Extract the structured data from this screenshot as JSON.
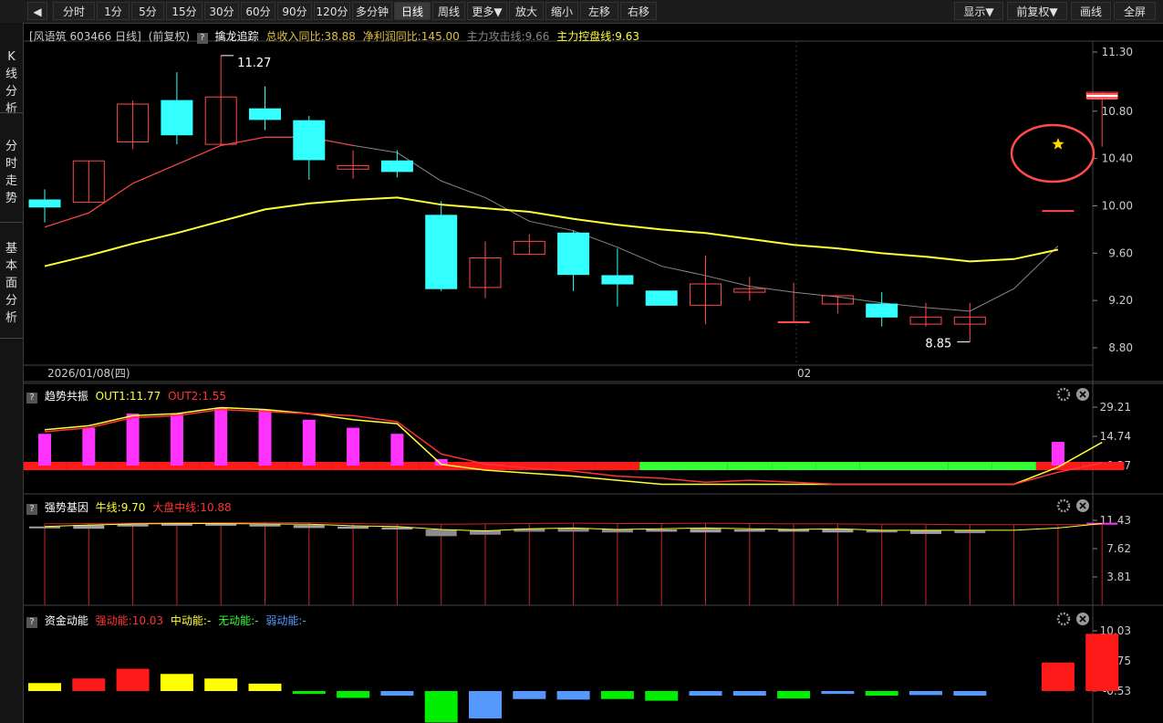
{
  "toolbar": {
    "back_icon": "back-arrow-icon",
    "left_buttons": [
      "分时",
      "1分",
      "5分",
      "15分",
      "30分",
      "60分",
      "90分",
      "120分",
      "多分钟",
      "日线",
      "周线",
      "更多▼",
      "放大",
      "缩小",
      "左移",
      "右移"
    ],
    "active": "日线",
    "right_buttons": [
      "显示▼",
      "前复权▼",
      "画线",
      "全屏"
    ]
  },
  "sidebar": {
    "tabs": [
      "K\n线\n分\n析",
      "分\n时\n走\n势",
      "基\n本\n面\n分\n析"
    ]
  },
  "header": {
    "stock": "[风语筑 603466 日线]",
    "adjust": "(前复权)",
    "indicator": "擒龙追踪",
    "items": [
      {
        "text": "总收入同比:38.88",
        "color": "#e0c040"
      },
      {
        "text": "净利润同比:145.00",
        "color": "#e0c040"
      },
      {
        "text": "主力攻击线:9.66",
        "color": "#888888"
      },
      {
        "text": "主力控盘线:9.63",
        "color": "#ffff33"
      }
    ]
  },
  "colors": {
    "up": "#ff4b4b",
    "down": "#33ffff",
    "ma_short": "#888888",
    "ma_long": "#ffff33",
    "magenta": "#ff33ff",
    "green": "#33ff33",
    "red_band": "#ff1a1a",
    "blue": "#5599ff"
  },
  "chart_data": [
    {
      "type": "candlestick",
      "title": "擒龙追踪",
      "x_labels": [
        "2026/01/08(四)",
        "02"
      ],
      "y_ticks": [
        11.3,
        10.8,
        10.4,
        10.0,
        9.6,
        9.2,
        8.8
      ],
      "ylim": [
        8.8,
        11.3
      ],
      "max_label": "11.27",
      "min_label": "8.85",
      "candles": [
        {
          "o": 10.05,
          "h": 10.14,
          "l": 9.86,
          "c": 9.99
        },
        {
          "o": 10.03,
          "h": 10.38,
          "l": 10.03,
          "c": 10.38
        },
        {
          "o": 10.54,
          "h": 10.89,
          "l": 10.48,
          "c": 10.86
        },
        {
          "o": 10.89,
          "h": 11.13,
          "l": 10.52,
          "c": 10.6
        },
        {
          "o": 10.52,
          "h": 11.27,
          "l": 10.52,
          "c": 10.92
        },
        {
          "o": 10.82,
          "h": 11.01,
          "l": 10.64,
          "c": 10.73
        },
        {
          "o": 10.72,
          "h": 10.76,
          "l": 10.22,
          "c": 10.39
        },
        {
          "o": 10.31,
          "h": 10.47,
          "l": 10.23,
          "c": 10.34
        },
        {
          "o": 10.38,
          "h": 10.47,
          "l": 10.24,
          "c": 10.29
        },
        {
          "o": 9.92,
          "h": 10.04,
          "l": 9.28,
          "c": 9.3
        },
        {
          "o": 9.31,
          "h": 9.7,
          "l": 9.22,
          "c": 9.56
        },
        {
          "o": 9.59,
          "h": 9.76,
          "l": 9.59,
          "c": 9.7
        },
        {
          "o": 9.77,
          "h": 9.79,
          "l": 9.28,
          "c": 9.42
        },
        {
          "o": 9.41,
          "h": 9.64,
          "l": 9.15,
          "c": 9.34
        },
        {
          "o": 9.28,
          "h": 9.28,
          "l": 9.16,
          "c": 9.16
        },
        {
          "o": 9.16,
          "h": 9.58,
          "l": 9.0,
          "c": 9.34
        },
        {
          "o": 9.27,
          "h": 9.4,
          "l": 9.2,
          "c": 9.3
        },
        {
          "o": 9.02,
          "h": 9.35,
          "l": 9.02,
          "c": 9.02
        },
        {
          "o": 9.17,
          "h": 9.24,
          "l": 9.09,
          "c": 9.24
        },
        {
          "o": 9.17,
          "h": 9.27,
          "l": 8.98,
          "c": 9.06
        },
        {
          "o": 9.0,
          "h": 9.18,
          "l": 8.98,
          "c": 9.06
        },
        {
          "o": 9.0,
          "h": 9.18,
          "l": 8.85,
          "c": 9.06
        },
        null,
        {
          "o": 9.96,
          "h": 9.96,
          "l": 9.96,
          "c": 9.96
        },
        {
          "o": 10.91,
          "h": 10.96,
          "l": 10.5,
          "c": 10.96
        }
      ],
      "series": [
        {
          "name": "主力攻击线",
          "color": "#888888",
          "values": [
            9.82,
            9.94,
            10.19,
            10.35,
            10.51,
            10.58,
            10.58,
            10.51,
            10.45,
            10.21,
            10.07,
            9.87,
            9.79,
            9.65,
            9.49,
            9.41,
            9.32,
            9.27,
            9.23,
            9.18,
            9.14,
            9.11,
            9.3,
            9.66
          ]
        },
        {
          "name": "主力控盘线",
          "color": "#ffff33",
          "values": [
            9.49,
            9.58,
            9.68,
            9.77,
            9.87,
            9.97,
            10.02,
            10.05,
            10.07,
            10.01,
            9.98,
            9.95,
            9.89,
            9.84,
            9.8,
            9.77,
            9.72,
            9.67,
            9.64,
            9.6,
            9.57,
            9.53,
            9.55,
            9.63
          ]
        }
      ],
      "marker": "star-icon"
    },
    {
      "type": "bar",
      "title": "趋势共振",
      "legend": [
        {
          "text": "OUT1:11.77",
          "color": "#ffff33"
        },
        {
          "text": "OUT2:1.55",
          "color": "#ff3333"
        }
      ],
      "y_ticks": [
        29.21,
        14.74,
        0.27
      ],
      "ylim": [
        0.27,
        29.21
      ],
      "values": [
        16,
        19,
        26,
        26,
        29,
        28,
        23,
        19,
        16,
        3.5,
        null,
        null,
        null,
        null,
        null,
        null,
        null,
        null,
        null,
        null,
        null,
        null,
        null,
        12
      ],
      "series": [
        {
          "name": "OUT1",
          "color": "#ffff33",
          "values": [
            18,
            20,
            25,
            26,
            29,
            28,
            26,
            23,
            21,
            0.9,
            -2,
            -3.5,
            -5,
            -7,
            -9,
            -9,
            -9,
            -9,
            -9,
            -9,
            -9,
            -9,
            -9,
            -0.5,
            11.77
          ]
        },
        {
          "name": "OUT2",
          "color": "#ff3333",
          "values": [
            17,
            19,
            24,
            25,
            28,
            27,
            26,
            25,
            22,
            6,
            1.0,
            -1,
            -2.5,
            -5,
            -6,
            -8,
            -7,
            -8,
            -9,
            -9,
            -9,
            -9,
            -9,
            -3,
            1.55
          ]
        }
      ],
      "band": [
        "red",
        "red",
        "red",
        "red",
        "red",
        "red",
        "red",
        "red",
        "red",
        "red",
        "red",
        "red",
        "red",
        "red",
        "green",
        "green",
        "green",
        "green",
        "green",
        "green",
        "green",
        "green",
        "green",
        "red",
        "red"
      ]
    },
    {
      "type": "bar",
      "title": "强势基因",
      "legend": [
        {
          "text": "牛线:9.70",
          "color": "#ffff33"
        },
        {
          "text": "大盘中线:10.88",
          "color": "#ff3333"
        }
      ],
      "y_ticks": [
        11.43,
        7.62,
        3.81
      ],
      "ylim": [
        0,
        11.43
      ],
      "bull_line": [
        10.6,
        10.8,
        10.95,
        11.0,
        11.0,
        10.95,
        10.9,
        10.7,
        10.6,
        10.2,
        10.0,
        10.3,
        10.4,
        10.2,
        10.3,
        10.4,
        10.3,
        10.2,
        10.3,
        10.1,
        10.1,
        10.1,
        10.1,
        10.4,
        11.0
      ],
      "market_line": [
        10.95,
        11.0,
        11.05,
        11.1,
        11.1,
        11.15,
        11.1,
        11.0,
        10.9,
        10.9,
        10.95,
        11.0,
        11.05,
        11.0,
        11.0,
        11.05,
        11.0,
        10.95,
        10.95,
        10.9,
        10.9,
        10.85,
        10.85,
        10.85,
        10.88
      ],
      "blocks": [
        [
          10.6,
          10.4
        ],
        [
          10.8,
          10.3
        ],
        [
          10.9,
          10.6
        ],
        [
          11.0,
          10.7
        ],
        [
          11.0,
          10.7
        ],
        [
          10.9,
          10.6
        ],
        [
          10.8,
          10.4
        ],
        [
          10.6,
          10.3
        ],
        [
          10.5,
          10.2
        ],
        [
          10.2,
          9.3
        ],
        [
          10.1,
          9.5
        ],
        [
          10.3,
          9.9
        ],
        [
          10.4,
          9.9
        ],
        [
          10.2,
          9.8
        ],
        [
          10.2,
          9.9
        ],
        [
          10.3,
          9.8
        ],
        [
          10.2,
          9.9
        ],
        [
          10.2,
          9.9
        ],
        [
          10.2,
          9.8
        ],
        [
          10.1,
          9.8
        ],
        [
          10.1,
          9.6
        ],
        [
          10.1,
          9.7
        ],
        [
          null,
          null
        ],
        [
          null,
          null
        ],
        [
          11.1,
          10.9
        ]
      ]
    },
    {
      "type": "bar",
      "title": "资金动能",
      "legend": [
        {
          "text": "强动能:10.03",
          "color": "#ff3333"
        },
        {
          "text": "中动能:-",
          "color": "#ffff33"
        },
        {
          "text": "无动能:-",
          "color": "#33ff33"
        },
        {
          "text": "弱动能:-",
          "color": "#5599ff"
        }
      ],
      "y_ticks": [
        10.03,
        4.75,
        -0.53
      ],
      "ylim": [
        -6,
        10.03
      ],
      "values": [
        1.4,
        2.2,
        3.9,
        3.0,
        2.2,
        1.3,
        -0.5,
        -1.2,
        -0.8,
        -5.5,
        -4.8,
        -1.4,
        -1.5,
        -1.4,
        -1.7,
        -0.8,
        -0.8,
        -1.3,
        -0.5,
        -0.8,
        -0.7,
        -0.8,
        null,
        5.0,
        10.03
      ],
      "colors": [
        "y",
        "r",
        "r",
        "y",
        "y",
        "y",
        "g",
        "g",
        "b",
        "g",
        "b",
        "b",
        "b",
        "g",
        "g",
        "b",
        "b",
        "g",
        "b",
        "g",
        "b",
        "b",
        null,
        "r",
        "r"
      ]
    }
  ]
}
